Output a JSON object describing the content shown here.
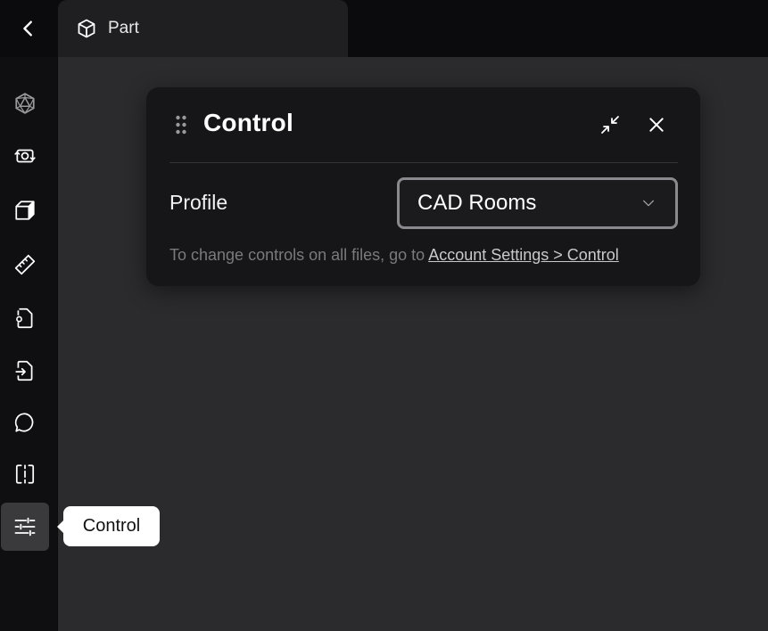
{
  "tab": {
    "label": "Part",
    "icon": "cube-icon"
  },
  "sidebar": {
    "items": [
      {
        "name": "sidebar-item-parts",
        "icon": "polyhedron-icon"
      },
      {
        "name": "sidebar-item-view",
        "icon": "rotate-camera-icon"
      },
      {
        "name": "sidebar-item-3d",
        "icon": "box-icon"
      },
      {
        "name": "sidebar-item-measure",
        "icon": "ruler-icon"
      },
      {
        "name": "sidebar-item-file-settings",
        "icon": "file-gear-icon"
      },
      {
        "name": "sidebar-item-import",
        "icon": "file-import-icon"
      },
      {
        "name": "sidebar-item-comments",
        "icon": "comment-icon"
      },
      {
        "name": "sidebar-item-section",
        "icon": "section-split-icon"
      },
      {
        "name": "sidebar-item-control",
        "icon": "sliders-icon",
        "active": true
      }
    ]
  },
  "panel": {
    "title": "Control",
    "profile_label": "Profile",
    "profile_value": "CAD Rooms",
    "hint_text": "To change controls on all files, go to ",
    "hint_link": "Account Settings > Control"
  },
  "tooltip": {
    "label": "Control"
  },
  "colors": {
    "background": "#0b0b0d",
    "canvas": "#2b2b2d",
    "panel": "#161618",
    "tab": "#1f1f21",
    "select_border": "#8a8a8e",
    "active_sidebar": "#3a3a3c"
  }
}
